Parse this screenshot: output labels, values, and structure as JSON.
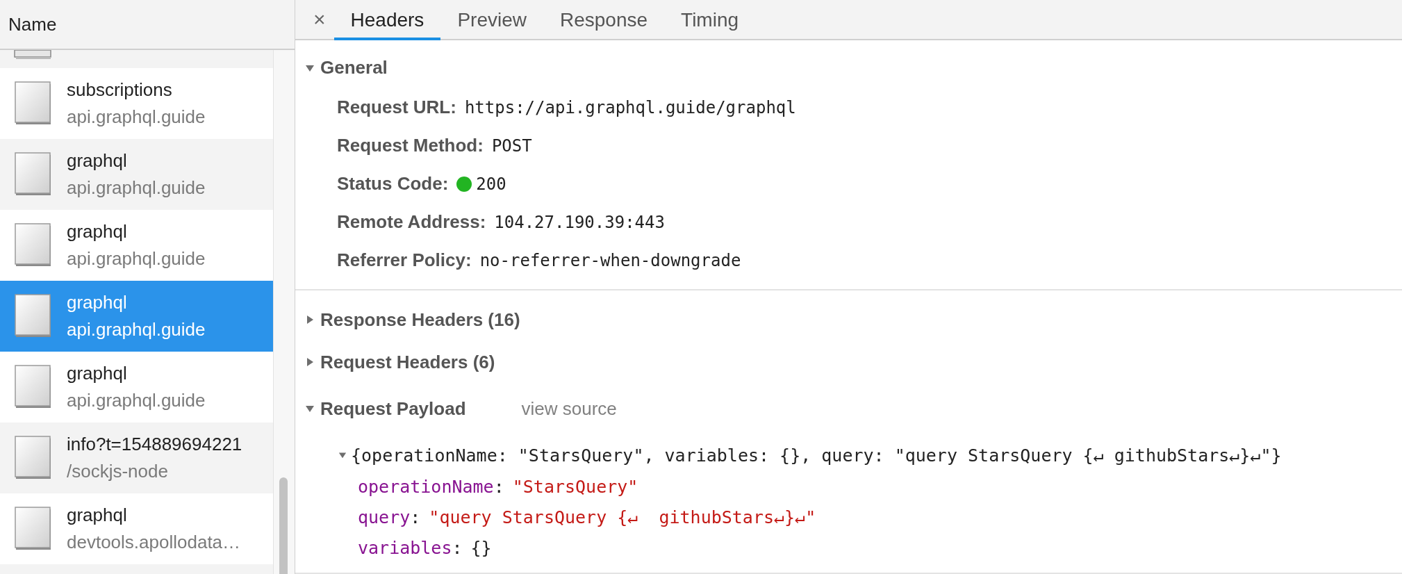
{
  "requests_panel": {
    "column_header": "Name",
    "requests": [
      {
        "name": "subscriptions",
        "domain": "api.graphql.guide",
        "selected": false
      },
      {
        "name": "graphql",
        "domain": "api.graphql.guide",
        "selected": false
      },
      {
        "name": "graphql",
        "domain": "api.graphql.guide",
        "selected": false
      },
      {
        "name": "graphql",
        "domain": "api.graphql.guide",
        "selected": true
      },
      {
        "name": "graphql",
        "domain": "api.graphql.guide",
        "selected": false
      },
      {
        "name": "info?t=154889694221",
        "domain": "/sockjs-node",
        "selected": false
      },
      {
        "name": "graphql",
        "domain": "devtools.apollodata…",
        "selected": false
      }
    ]
  },
  "details": {
    "close_button": "×",
    "tabs": [
      {
        "label": "Headers",
        "selected": true
      },
      {
        "label": "Preview",
        "selected": false
      },
      {
        "label": "Response",
        "selected": false
      },
      {
        "label": "Timing",
        "selected": false
      }
    ],
    "general": {
      "title": "General",
      "expanded": true,
      "fields": [
        {
          "label": "Request URL:",
          "value": "https://api.graphql.guide/graphql"
        },
        {
          "label": "Request Method:",
          "value": "POST"
        },
        {
          "label": "Status Code:",
          "value": "200",
          "color": "#22b422"
        },
        {
          "label": "Remote Address:",
          "value": "104.27.190.39:443"
        },
        {
          "label": "Referrer Policy:",
          "value": "no-referrer-when-downgrade"
        }
      ]
    },
    "collapsed_sections": [
      {
        "title": "Response Headers (16)",
        "expanded": false
      },
      {
        "title": "Request Headers (6)",
        "expanded": false
      }
    ],
    "payload": {
      "title": "Request Payload",
      "expanded": true,
      "source_link": "view source",
      "object": {
        "summary": "{operationName: \"StarsQuery\", variables: {}, query: \"query StarsQuery {↵ githubStars↵}↵\"}",
        "expanded": true,
        "properties": [
          {
            "key": "operationName",
            "separator": ":",
            "value": "\"StarsQuery\"",
            "kind": "string"
          },
          {
            "key": "query",
            "separator": ":",
            "value": "\"query StarsQuery {↵  githubStars↵}↵\"",
            "kind": "string"
          },
          {
            "key": "variables",
            "separator": ":",
            "value": "{}",
            "kind": "object"
          }
        ]
      }
    }
  }
}
